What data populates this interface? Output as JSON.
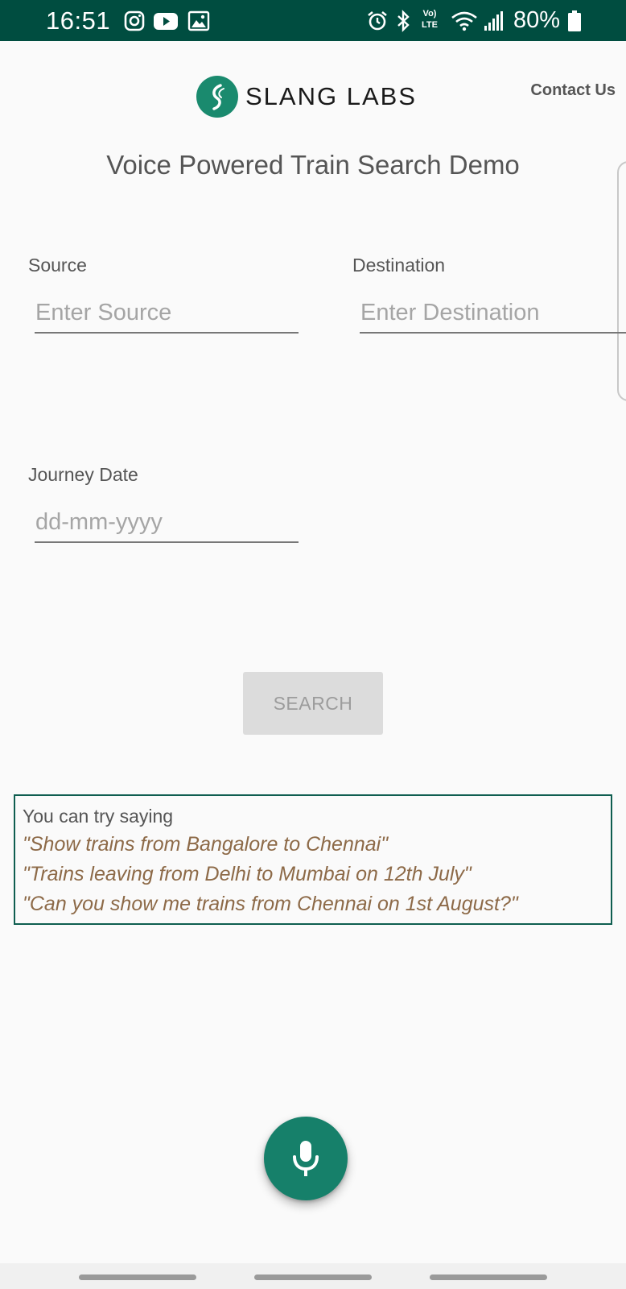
{
  "status_bar": {
    "time": "16:51",
    "network": "Vo) LTE",
    "battery": "80%",
    "bg_color": "#004d40"
  },
  "header": {
    "logo_text": "SLANG LABS",
    "contact_label": "Contact Us",
    "brand_color": "#1a8a6e"
  },
  "page": {
    "title": "Voice Powered Train Search Demo"
  },
  "form": {
    "source_label": "Source",
    "source_placeholder": "Enter Source",
    "source_value": "",
    "destination_label": "Destination",
    "destination_placeholder": "Enter Destination",
    "destination_value": "",
    "date_label": "Journey Date",
    "date_placeholder": "dd-mm-yyyy",
    "date_value": "",
    "search_label": "SEARCH"
  },
  "hints": {
    "heading": "You can try saying",
    "examples": [
      "\"Show trains from Bangalore to Chennai\"",
      "\"Trains leaving from Delhi to Mumbai on 12th July\"",
      "\"Can you show me trains from Chennai on 1st August?\""
    ]
  },
  "mic": {
    "icon": "microphone-icon"
  }
}
